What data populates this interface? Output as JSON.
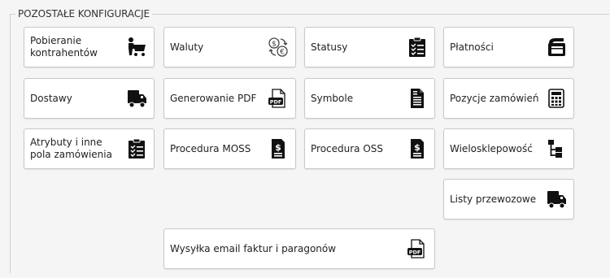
{
  "panel": {
    "title": "POZOSTAŁE KONFIGURACJE"
  },
  "tiles": {
    "pobieranie_kontrahentow": {
      "label": "Pobieranie\nkontrahentów",
      "icon": "shopping-cart-user-icon"
    },
    "waluty": {
      "label": "Waluty",
      "icon": "currency-exchange-icon"
    },
    "statusy": {
      "label": "Statusy",
      "icon": "clipboard-checklist-icon"
    },
    "platnosci": {
      "label": "Płatności",
      "icon": "wallet-icon"
    },
    "dostawy": {
      "label": "Dostawy",
      "icon": "delivery-truck-icon"
    },
    "generowanie_pdf": {
      "label": "Generowanie PDF",
      "icon": "pdf-file-icon"
    },
    "symbole": {
      "label": "Symbole",
      "icon": "zip-file-icon"
    },
    "pozycje_zamowien": {
      "label": "Pozycje zamówień",
      "icon": "calculator-icon"
    },
    "atrybuty": {
      "label": "Atrybuty i inne\npola zamówienia",
      "icon": "clipboard-list-icon"
    },
    "procedura_moss": {
      "label": "Procedura MOSS",
      "icon": "dollar-document-icon"
    },
    "procedura_oss": {
      "label": "Procedura OSS",
      "icon": "dollar-document-icon"
    },
    "wielosklepowosc": {
      "label": "Wielosklepowość",
      "icon": "hierarchy-tree-icon"
    },
    "listy_przewozowe": {
      "label": "Listy przewozowe",
      "icon": "delivery-truck-icon"
    },
    "wysylka_email": {
      "label": "Wysyłka email faktur i paragonów",
      "icon": "pdf-file-icon"
    }
  }
}
